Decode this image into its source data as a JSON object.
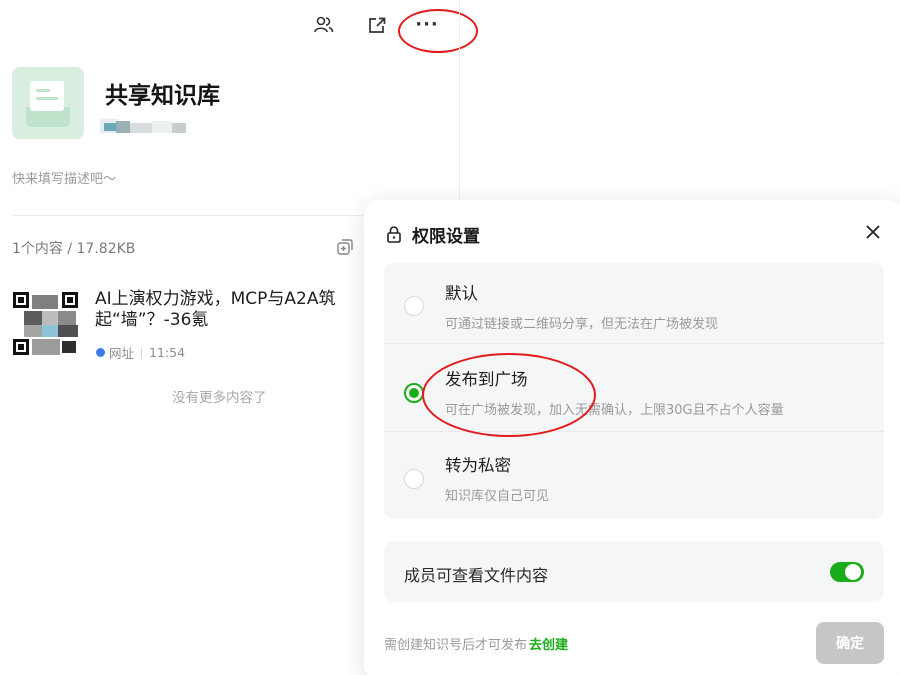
{
  "toolbar": {
    "members_icon": "members-icon",
    "share_icon": "share-icon",
    "more_label": "···"
  },
  "kb": {
    "cover_icon": "document-icon",
    "title": "共享知识库",
    "description": "快来填写描述吧～",
    "stats": "1个内容 / 17.82KB",
    "add_icon": "add-content-icon"
  },
  "items": [
    {
      "title": "AI上演权力游戏，MCP与A2A筑起“墙”？-36氪",
      "source": "网址",
      "time": "11:54"
    }
  ],
  "list_end_text": "没有更多内容了",
  "permission_dialog": {
    "title": "权限设置",
    "lock_icon": "lock-icon",
    "close_icon": "close-icon",
    "options": [
      {
        "label": "默认",
        "desc": "可通过链接或二维码分享，但无法在广场被发现",
        "selected": false
      },
      {
        "label": "发布到广场",
        "desc": "可在广场被发现，加入无需确认，上限30G且不占个人容量",
        "selected": true
      },
      {
        "label": "转为私密",
        "desc": "知识库仅自己可见",
        "selected": false
      }
    ],
    "member_view_label": "成员可查看文件内容",
    "member_view_enabled": true,
    "footer_note": "需创建知识号后才可发布",
    "create_link": "去创建",
    "confirm_label": "确定"
  },
  "colors": {
    "accent_green": "#1aad19",
    "annotation_red": "#e21b1b",
    "disabled_button": "#c6c6c6"
  }
}
